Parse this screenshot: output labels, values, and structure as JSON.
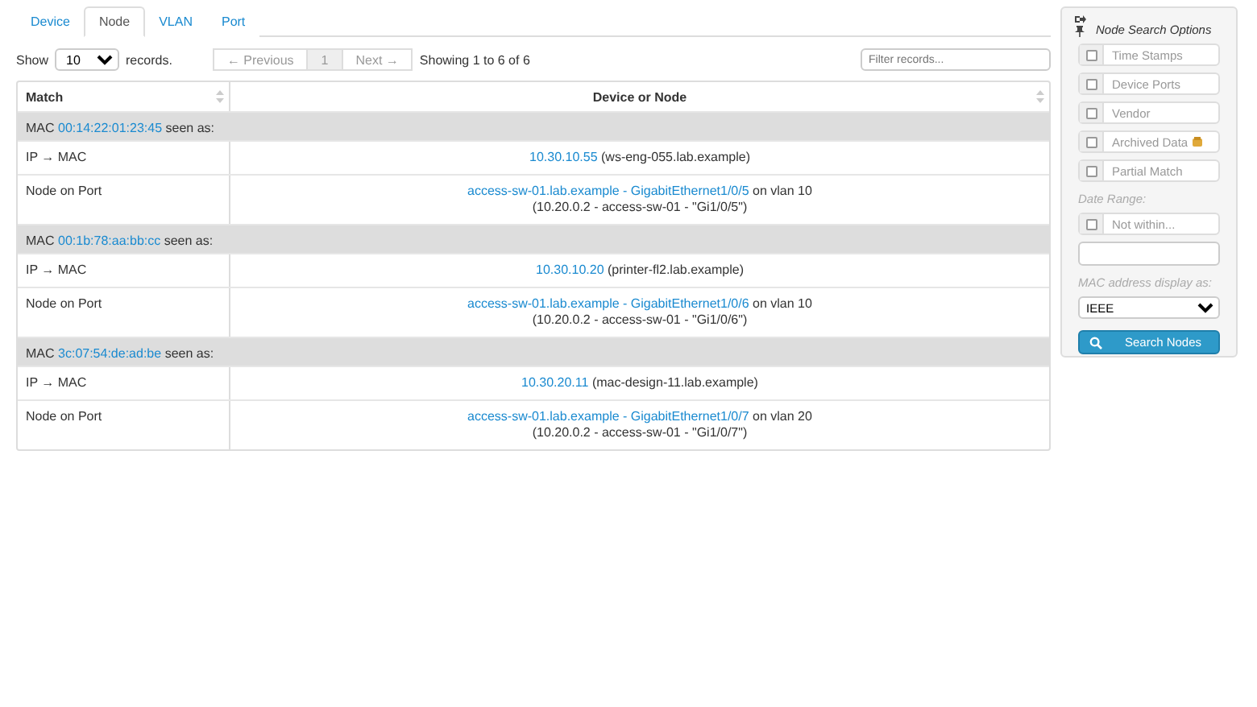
{
  "tabs": [
    {
      "label": "Device",
      "selected": false
    },
    {
      "label": "Node",
      "selected": true
    },
    {
      "label": "VLAN",
      "selected": false
    },
    {
      "label": "Port",
      "selected": false
    }
  ],
  "length_control": {
    "before": "Show",
    "value": "10",
    "after": "records."
  },
  "pager": {
    "previous": "← Previous",
    "page": "1",
    "next": "Next →",
    "info": "Showing 1 to 6 of 6"
  },
  "filter": {
    "placeholder": "Filter records..."
  },
  "table": {
    "columns": [
      "Match",
      "Device or Node"
    ],
    "groups": [
      {
        "prefix": "MAC",
        "mac": "00:14:22:01:23:45",
        "suffix": "seen as:",
        "ip_row": {
          "label": "IP → MAC",
          "ip": "10.30.10.55",
          "host": "(ws-eng-055.lab.example)"
        },
        "port_row": {
          "label": "Node on Port",
          "link": "access-sw-01.lab.example - GigabitEthernet1/0/5",
          "vlan": "on vlan 10",
          "detail": "(10.20.0.2 - access-sw-01 - \"Gi1/0/5\")"
        }
      },
      {
        "prefix": "MAC",
        "mac": "00:1b:78:aa:bb:cc",
        "suffix": "seen as:",
        "ip_row": {
          "label": "IP → MAC",
          "ip": "10.30.10.20",
          "host": "(printer-fl2.lab.example)"
        },
        "port_row": {
          "label": "Node on Port",
          "link": "access-sw-01.lab.example - GigabitEthernet1/0/6",
          "vlan": "on vlan 10",
          "detail": "(10.20.0.2 - access-sw-01 - \"Gi1/0/6\")"
        }
      },
      {
        "prefix": "MAC",
        "mac": "3c:07:54:de:ad:be",
        "suffix": "seen as:",
        "ip_row": {
          "label": "IP → MAC",
          "ip": "10.30.20.11",
          "host": "(mac-design-11.lab.example)"
        },
        "port_row": {
          "label": "Node on Port",
          "link": "access-sw-01.lab.example - GigabitEthernet1/0/7",
          "vlan": "on vlan 20",
          "detail": "(10.20.0.2 - access-sw-01 - \"Gi1/0/7\")"
        }
      }
    ]
  },
  "sidebar": {
    "title": "Node Search Options",
    "options": [
      {
        "label": "Time Stamps",
        "checked": false
      },
      {
        "label": "Device Ports",
        "checked": false
      },
      {
        "label": "Vendor",
        "checked": false
      },
      {
        "label": "Archived Data",
        "checked": false,
        "has_info_icon": true
      },
      {
        "label": "Partial Match",
        "checked": false
      }
    ],
    "date_range_label": "Date Range:",
    "date_option": {
      "label": "Not within...",
      "checked": false
    },
    "mac_format_label": "MAC address display as:",
    "mac_format": "IEEE",
    "search_button": "Search Nodes"
  }
}
